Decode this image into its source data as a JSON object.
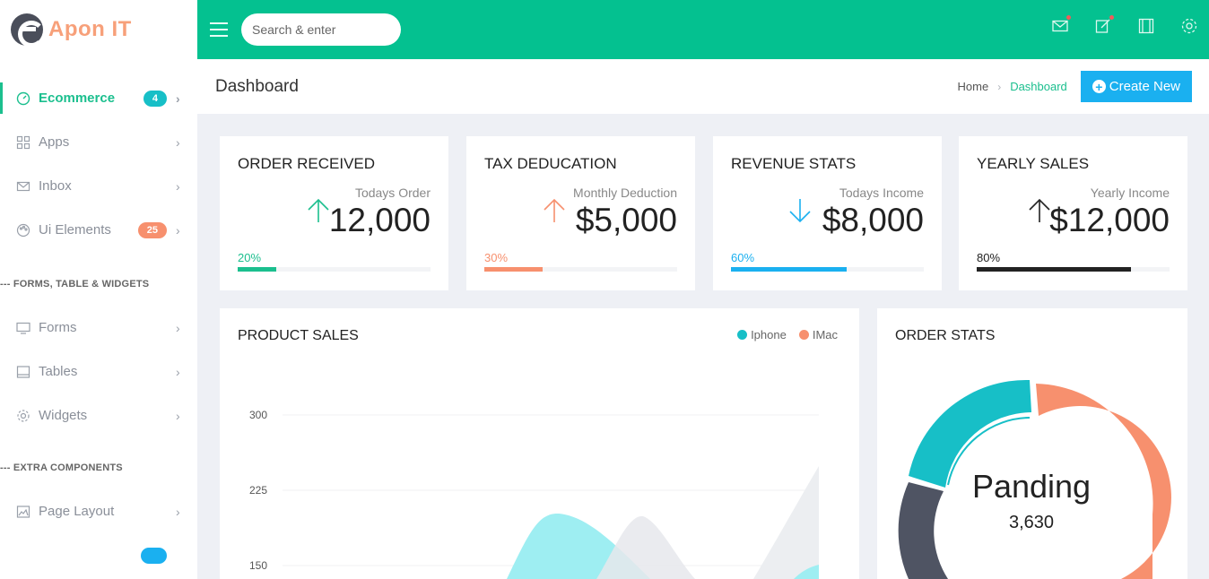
{
  "brand": {
    "name": "Apon IT"
  },
  "sidebar": {
    "items": [
      {
        "label": "Ecommerce",
        "badge": "4",
        "icon": "speedometer-icon"
      },
      {
        "label": "Apps",
        "icon": "grid-icon"
      },
      {
        "label": "Inbox",
        "icon": "envelope-icon"
      },
      {
        "label": "Ui Elements",
        "badge": "25",
        "icon": "palette-icon"
      }
    ],
    "section1": "--- FORMS, TABLE & WIDGETS",
    "items2": [
      {
        "label": "Forms",
        "icon": "monitor-icon"
      },
      {
        "label": "Tables",
        "icon": "table-icon"
      },
      {
        "label": "Widgets",
        "icon": "gear-icon"
      }
    ],
    "section2": "--- EXTRA COMPONENTS",
    "items3": [
      {
        "label": "Page Layout",
        "icon": "layout-icon"
      }
    ]
  },
  "topbar": {
    "search_placeholder": "Search & enter",
    "icons": [
      "mail-icon",
      "edit-icon",
      "panel-icon",
      "settings-icon"
    ]
  },
  "header": {
    "title": "Dashboard",
    "breadcrumb_home": "Home",
    "breadcrumb_current": "Dashboard",
    "create_label": "Create New"
  },
  "cards": [
    {
      "title": "ORDER RECEIVED",
      "sub": "Todays Order",
      "value": "12,000",
      "pct_label": "20%",
      "progress": 0.2,
      "color": "#1bbf8e",
      "arrow": "up"
    },
    {
      "title": "TAX DEDUCATION",
      "sub": "Monthly Deduction",
      "value": "$5,000",
      "pct_label": "30%",
      "progress": 0.3,
      "color": "#f7906e",
      "arrow": "up"
    },
    {
      "title": "REVENUE STATS",
      "sub": "Todays Income",
      "value": "$8,000",
      "pct_label": "60%",
      "progress": 0.6,
      "color": "#1ab0f0",
      "arrow": "down"
    },
    {
      "title": "YEARLY SALES",
      "sub": "Yearly Income",
      "value": "$12,000",
      "pct_label": "80%",
      "progress": 0.8,
      "color": "#222222",
      "arrow": "up"
    }
  ],
  "product_sales": {
    "title": "PRODUCT SALES",
    "legend": [
      {
        "name": "Iphone",
        "color": "#17bfc7"
      },
      {
        "name": "IMac",
        "color": "#f7906e"
      }
    ]
  },
  "order_stats": {
    "title": "ORDER STATS",
    "center_label": "Panding",
    "center_value": "3,630"
  },
  "chart_data": {
    "type": "area",
    "ylim": [
      150,
      300
    ],
    "yticks": [
      "300",
      "225",
      "150"
    ],
    "series": [
      {
        "name": "Iphone",
        "color": "#9eeef2"
      },
      {
        "name": "IMac",
        "color": "#eceef1"
      }
    ]
  },
  "donut_data": {
    "type": "pie",
    "segments": [
      {
        "color": "#f7906e",
        "value": 0.48
      },
      {
        "color": "#4f5463",
        "value": 0.2
      },
      {
        "color": "#17bfc7",
        "value": 0.22
      }
    ]
  }
}
